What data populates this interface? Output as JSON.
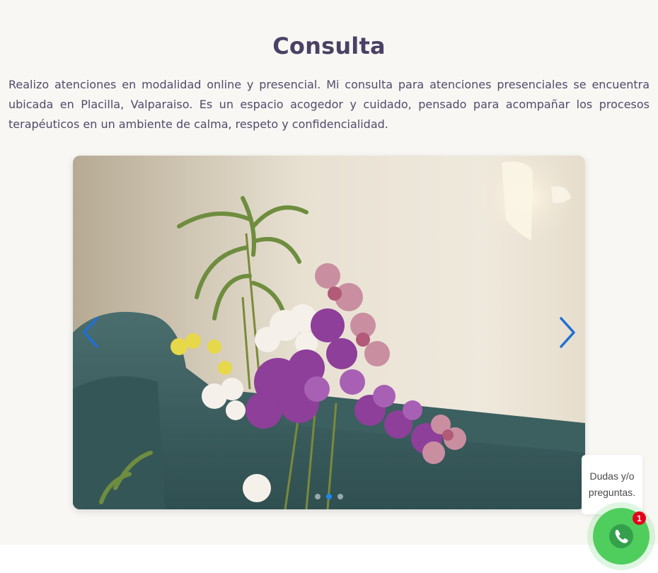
{
  "section": {
    "title": "Consulta",
    "intro": "Realizo atenciones en modalidad online y presencial. Mi consulta para atenciones presenciales se encuentra ubicada en Placilla, Valparaiso. Es un espacio acogedor y cuidado, pensado para acompañar los procesos terapéuticos en un ambiente de calma, respeto y confidencialidad."
  },
  "carousel": {
    "prev_icon": "chevron-left-icon",
    "next_icon": "chevron-right-icon",
    "slide_count": 3,
    "active_index": 1,
    "accent_color": "#1e88e5"
  },
  "whatsapp": {
    "bubble_text": "Dudas y/o preguntas.",
    "badge_count": "1",
    "icon": "phone-icon",
    "color": "#4fce5d"
  },
  "colors": {
    "title": "#4a4164",
    "text": "#524a6b",
    "background": "#f8f7f3"
  }
}
